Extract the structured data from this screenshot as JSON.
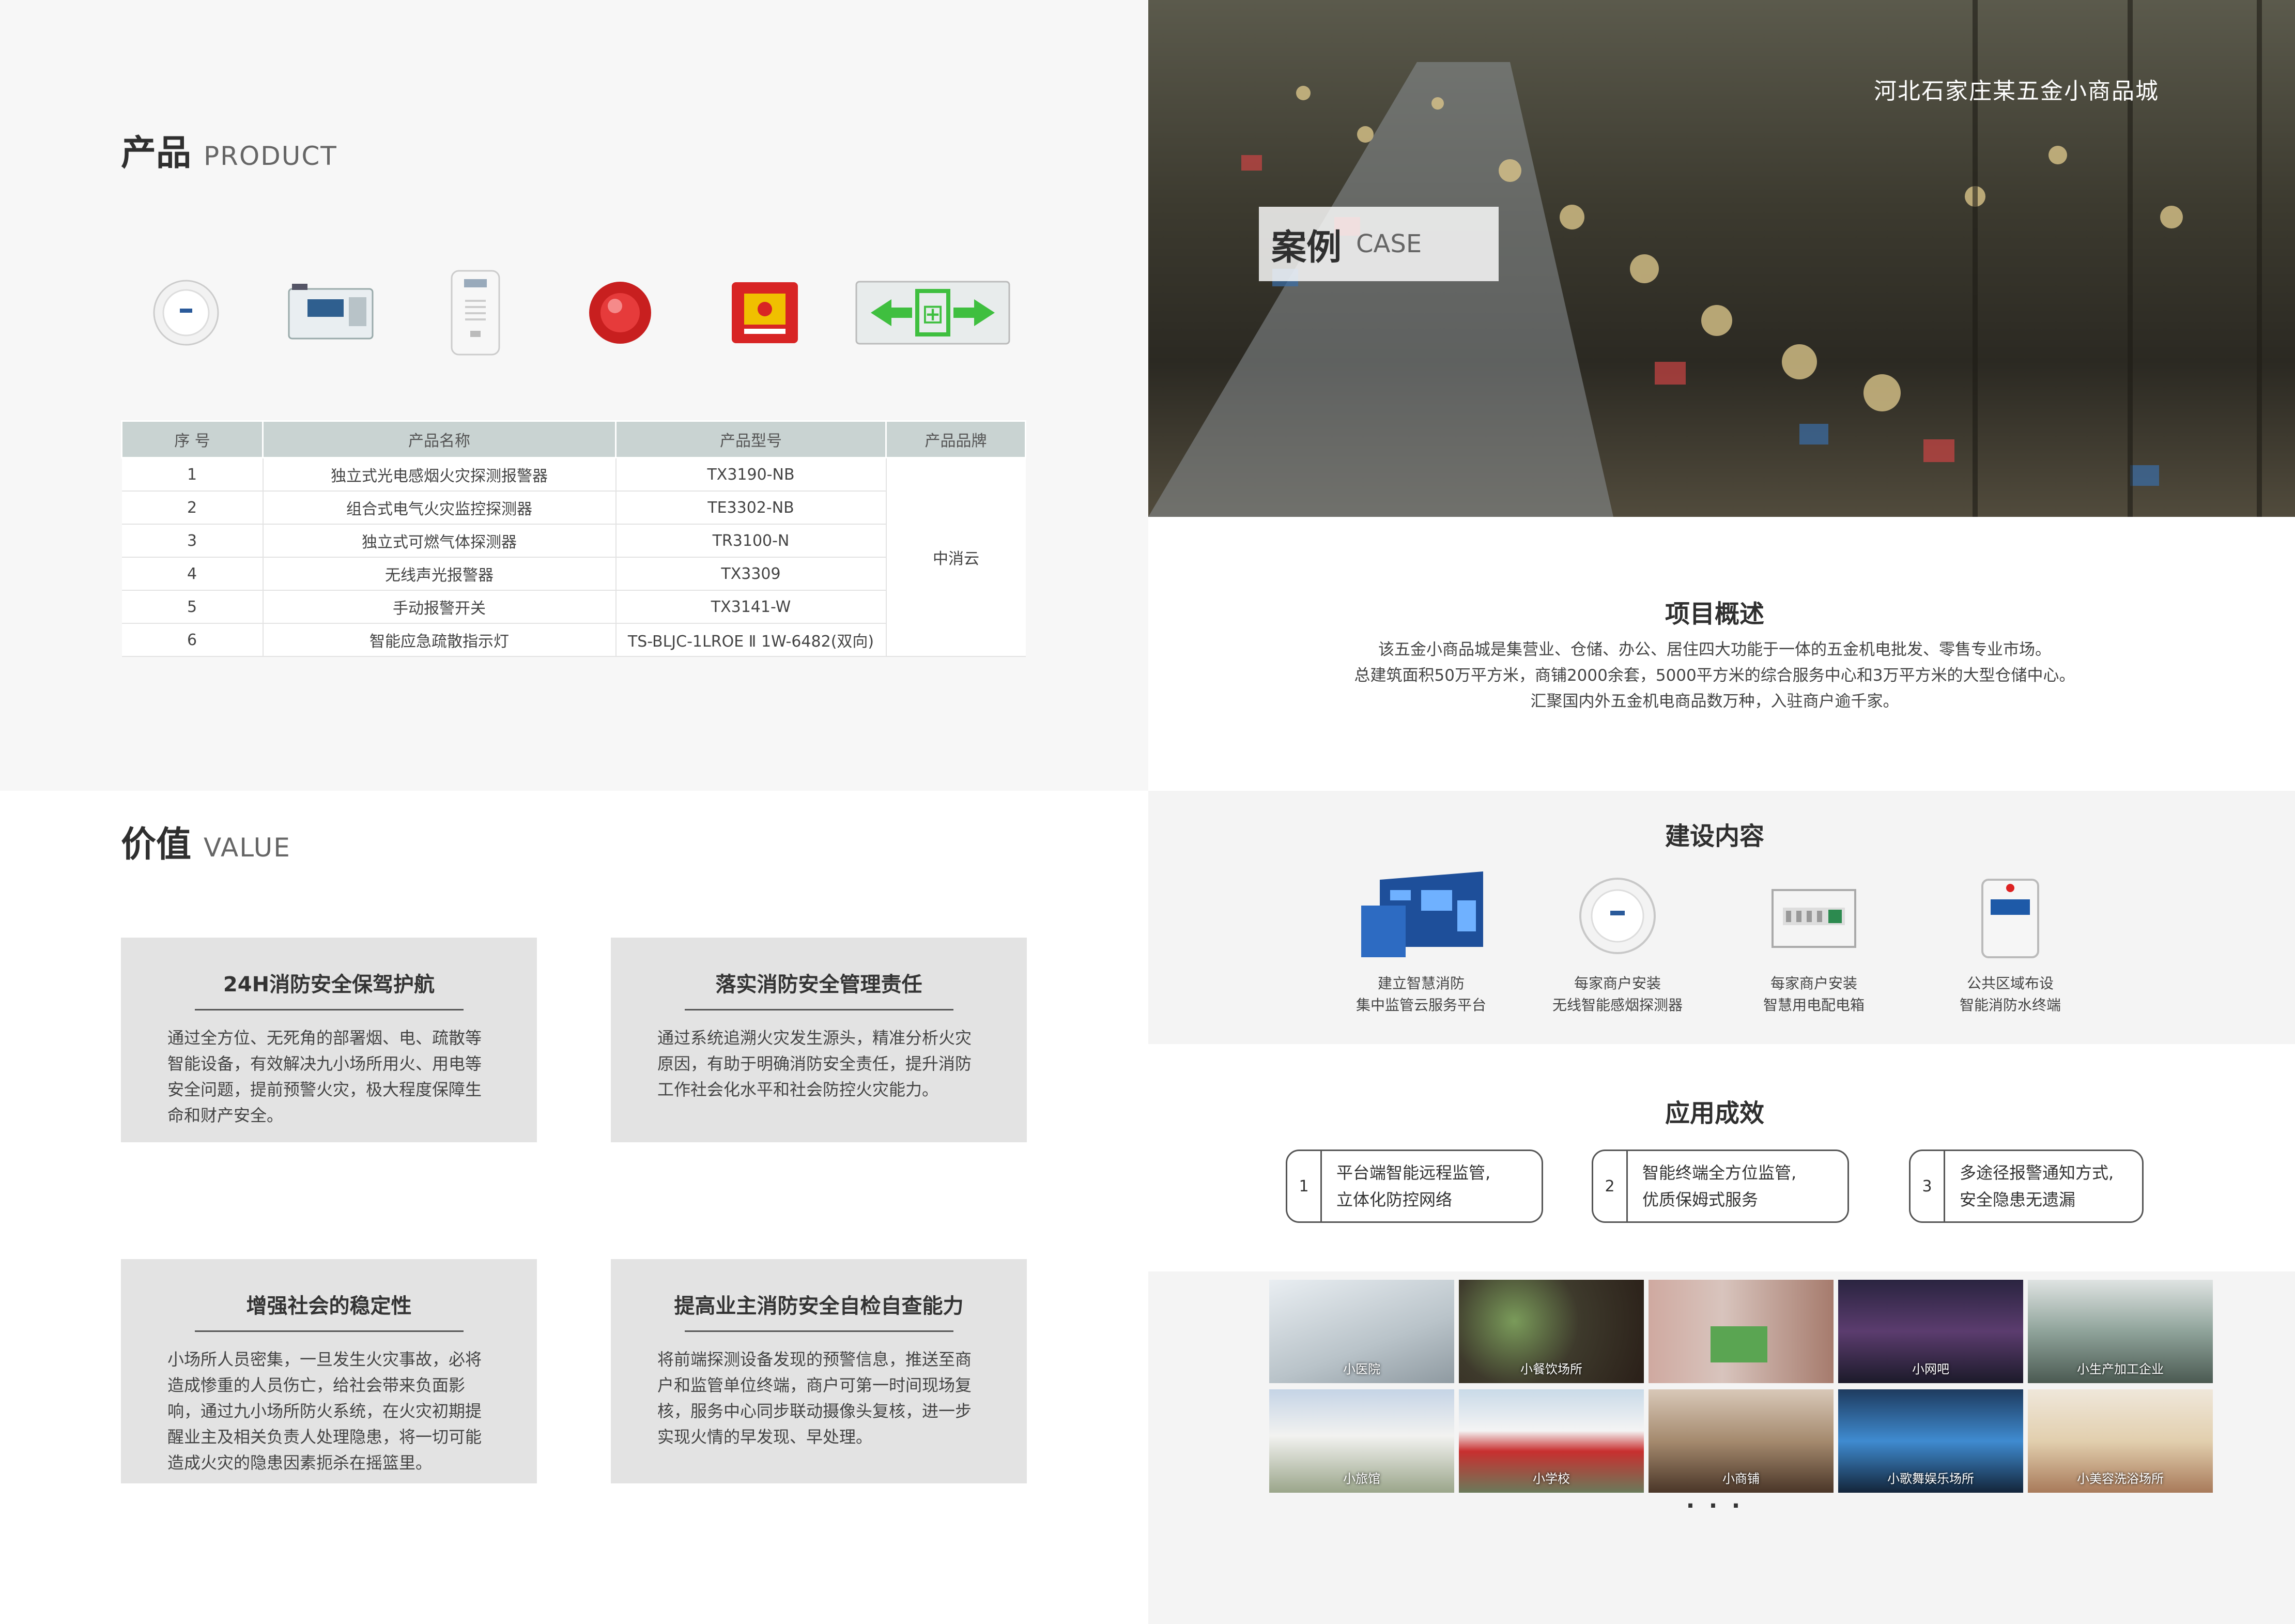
{
  "product": {
    "title": "产品",
    "title_en": "PRODUCT",
    "icons": [
      "smoke-detector-icon",
      "monitor-module-icon",
      "gas-detector-icon",
      "sound-light-alarm-icon",
      "manual-alarm-switch-icon",
      "exit-sign-icon"
    ],
    "table": {
      "headers": [
        "序 号",
        "产品名称",
        "产品型号",
        "产品品牌"
      ],
      "rows": [
        {
          "no": "1",
          "name": "独立式光电感烟火灾探测报警器",
          "model": "TX3190-NB"
        },
        {
          "no": "2",
          "name": "组合式电气火灾监控探测器",
          "model": "TE3302-NB"
        },
        {
          "no": "3",
          "name": "独立式可燃气体探测器",
          "model": "TR3100-N"
        },
        {
          "no": "4",
          "name": "无线声光报警器",
          "model": "TX3309"
        },
        {
          "no": "5",
          "name": "手动报警开关",
          "model": "TX3141-W"
        },
        {
          "no": "6",
          "name": "智能应急疏散指示灯",
          "model": "TS-BLJC-1LROE Ⅱ 1W-6482(双向)"
        }
      ],
      "brand": "中消云"
    }
  },
  "value": {
    "title": "价值",
    "title_en": "VALUE",
    "cards": [
      {
        "title": "24H消防安全保驾护航",
        "body": "通过全方位、无死角的部署烟、电、疏散等智能设备，有效解决九小场所用火、用电等安全问题，提前预警火灾，极大程度保障生命和财产安全。"
      },
      {
        "title": "落实消防安全管理责任",
        "body": "通过系统追溯火灾发生源头，精准分析火灾原因，有助于明确消防安全责任，提升消防工作社会化水平和社会防控火灾能力。"
      },
      {
        "title": "增强社会的稳定性",
        "body": "小场所人员密集，一旦发生火灾事故，必将造成惨重的人员伤亡，给社会带来负面影响，通过九小场所防火系统，在火灾初期提醒业主及相关负责人处理隐患，将一切可能造成火灾的隐患因素扼杀在摇篮里。"
      },
      {
        "title": "提高业主消防安全自检自查能力",
        "body": "将前端探测设备发现的预警信息，推送至商户和监管单位终端，商户可第一时间现场复核，服务中心同步联动摄像头复核，进一步实现火情的早发现、早处理。"
      }
    ]
  },
  "case": {
    "title": "案例",
    "title_en": "CASE",
    "location": "河北石家庄某五金小商品城",
    "overview_title": "项目概述",
    "overview_lines": [
      "该五金小商品城是集营业、仓储、办公、居住四大功能于一体的五金机电批发、零售专业市场。",
      "总建筑面积50万平方米，商铺2000余套，5000平方米的综合服务中心和3万平方米的大型仓储中心。",
      "汇聚国内外五金机电商品数万种，入驻商户逾千家。"
    ],
    "build_title": "建设内容",
    "build_items": [
      {
        "icon": "dashboard-screen-icon",
        "l1": "建立智慧消防",
        "l2": "集中监管云服务平台"
      },
      {
        "icon": "smoke-detector-icon",
        "l1": "每家商户安装",
        "l2": "无线智能感烟探测器"
      },
      {
        "icon": "distribution-box-icon",
        "l1": "每家商户安装",
        "l2": "智慧用电配电箱"
      },
      {
        "icon": "water-terminal-icon",
        "l1": "公共区域布设",
        "l2": "智能消防水终端"
      }
    ],
    "effect_title": "应用成效",
    "effects": [
      {
        "num": "1",
        "l1": "平台端智能远程监管,",
        "l2": "立体化防控网络"
      },
      {
        "num": "2",
        "l1": "智能终端全方位监管,",
        "l2": "优质保姆式服务"
      },
      {
        "num": "3",
        "l1": "多途径报警通知方式,",
        "l2": "安全隐患无遗漏"
      }
    ],
    "places": [
      "小医院",
      "小餐饮场所",
      "",
      "小网吧",
      "小生产加工企业",
      "小旅馆",
      "小学校",
      "小商铺",
      "小歌舞娱乐场所",
      "小美容洗浴场所"
    ],
    "more": "· · ·"
  },
  "colors": {
    "table_header": "#c9d3d2",
    "card_bg": "#e3e3e3",
    "exit_green": "#3fbf3f",
    "alarm_red": "#d82424"
  }
}
